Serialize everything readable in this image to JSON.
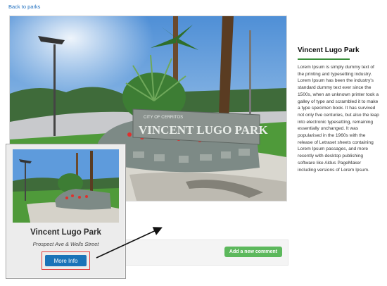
{
  "nav": {
    "back_label": "Back to parks"
  },
  "photo": {
    "sign_top": "CITY OF CERRITOS",
    "sign_text": "VINCENT LUGO PARK"
  },
  "park": {
    "title": "Vincent Lugo Park",
    "description": "Lorem Ipsum is simply dummy text of the printing and typesetting industry. Lorem Ipsum has been the industry's standard dummy text ever since the 1500s, when an unknown printer took a galley of type and scrambled it to make a type specimen book. It has survived not only five centuries, but also the leap into electronic typesetting, remaining essentially unchanged. It was popularised in the 1960s with the release of Letraset sheets containing Lorem Ipsum passages, and more recently with desktop publishing software like Aldus PageMaker including versions of Lorem Ipsum."
  },
  "comments": {
    "add_label": "Add a new comment"
  },
  "card": {
    "title": "Vincent Lugo Park",
    "address": "Prospect Ave & Wells Street",
    "button_label": "More Info"
  },
  "colors": {
    "link": "#1f6fbf",
    "accent_green": "#5cb85c",
    "underline_green": "#3a8f3a",
    "button_blue": "#1a73b8",
    "highlight_red": "#e23b3b"
  }
}
